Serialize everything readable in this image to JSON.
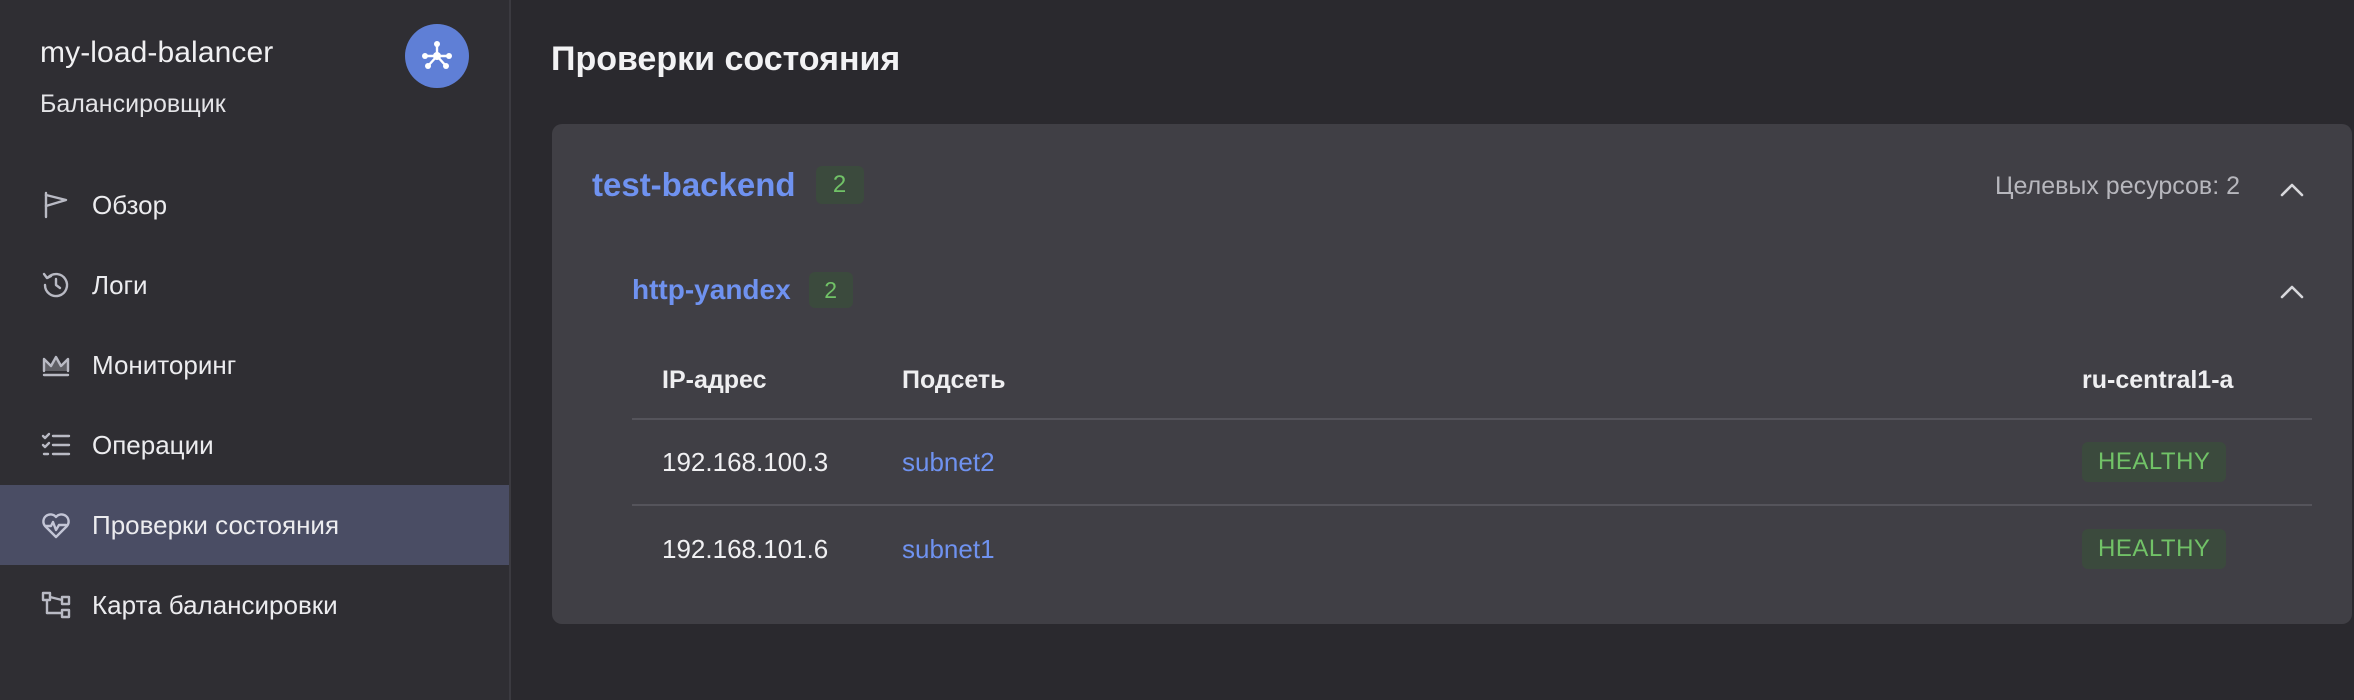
{
  "sidebar": {
    "title": "my-load-balancer",
    "subtitle": "Балансировщик",
    "logo_icon": "network-icon",
    "accent_color": "#5f7fd6",
    "items": [
      {
        "label": "Обзор",
        "icon": "flag-icon",
        "active": false
      },
      {
        "label": "Логи",
        "icon": "history-icon",
        "active": false
      },
      {
        "label": "Мониторинг",
        "icon": "chart-area-icon",
        "active": false
      },
      {
        "label": "Операции",
        "icon": "list-check-icon",
        "active": false
      },
      {
        "label": "Проверки состояния",
        "icon": "heart-pulse-icon",
        "active": true
      },
      {
        "label": "Карта балансировки",
        "icon": "topology-icon",
        "active": false
      }
    ]
  },
  "main": {
    "title": "Проверки состояния",
    "group": {
      "name": "test-backend",
      "count": "2",
      "targets_label": "Целевых ресурсов: 2",
      "health_check": {
        "name": "http-yandex",
        "count": "2",
        "columns": [
          "IP-адрес",
          "Подсеть",
          "ru-central1-a"
        ],
        "rows": [
          {
            "ip": "192.168.100.3",
            "subnet": "subnet2",
            "status": "HEALTHY"
          },
          {
            "ip": "192.168.101.6",
            "subnet": "subnet1",
            "status": "HEALTHY"
          }
        ]
      }
    }
  },
  "colors": {
    "link": "#6f92f0",
    "healthy_text": "#71c267",
    "healthy_bg": "#3b4a3d",
    "active_nav": "#4a4d64"
  }
}
